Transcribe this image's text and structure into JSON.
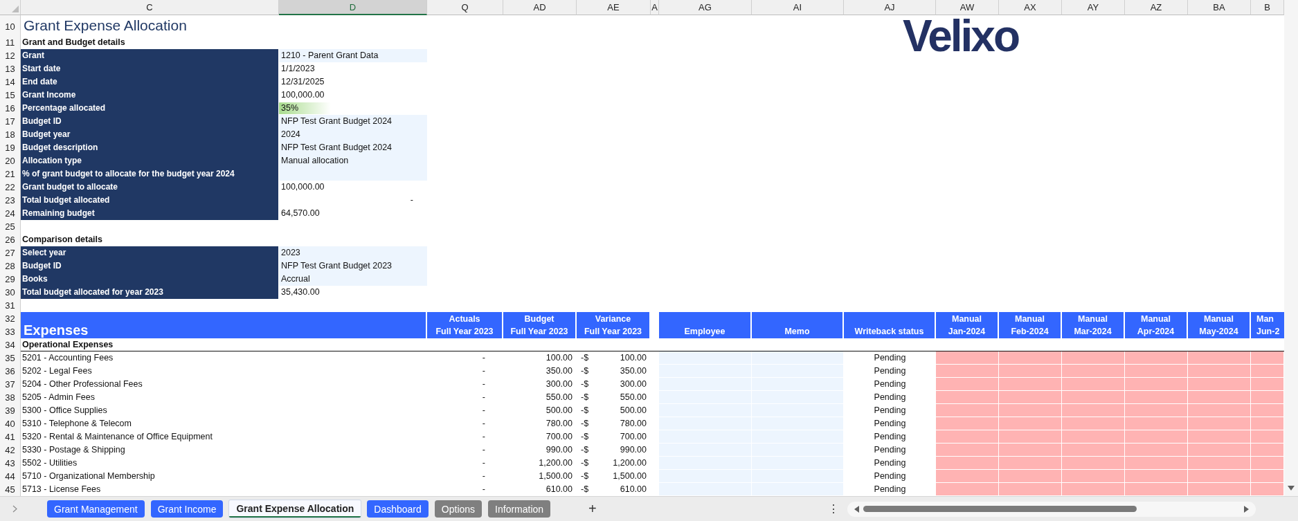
{
  "column_headers": [
    {
      "label": "C",
      "selected": false
    },
    {
      "label": "D",
      "selected": true
    },
    {
      "label": "Q",
      "selected": false
    },
    {
      "label": "AD",
      "selected": false
    },
    {
      "label": "AE",
      "selected": false
    },
    {
      "label": "A",
      "selected": false
    },
    {
      "label": "AG",
      "selected": false
    },
    {
      "label": "AI",
      "selected": false
    },
    {
      "label": "AJ",
      "selected": false
    },
    {
      "label": "AW",
      "selected": false
    },
    {
      "label": "AX",
      "selected": false
    },
    {
      "label": "AY",
      "selected": false
    },
    {
      "label": "AZ",
      "selected": false
    },
    {
      "label": "BA",
      "selected": false
    },
    {
      "label": "B",
      "selected": false
    }
  ],
  "logo": "Velixo",
  "top_rows": [
    {
      "row": "10",
      "kind": "title",
      "text": "Grant Expense Allocation"
    },
    {
      "row": "11",
      "kind": "heading",
      "text": "Grant and Budget details"
    },
    {
      "row": "12",
      "kind": "field",
      "label": "Grant",
      "value": "1210 - Parent Grant Data",
      "shaded": true
    },
    {
      "row": "13",
      "kind": "field",
      "label": "Start date",
      "value": "1/1/2023",
      "shaded": false
    },
    {
      "row": "14",
      "kind": "field",
      "label": "End date",
      "value": "12/31/2025",
      "shaded": false
    },
    {
      "row": "15",
      "kind": "field",
      "label": "Grant Income",
      "value": "100,000.00",
      "shaded": false
    },
    {
      "row": "16",
      "kind": "field",
      "label": "Percentage allocated",
      "value": "35%",
      "shaded": false,
      "level": 0.35
    },
    {
      "row": "17",
      "kind": "field",
      "label": "Budget ID",
      "value": "NFP Test Grant Budget 2024",
      "shaded": true
    },
    {
      "row": "18",
      "kind": "field",
      "label": "Budget year",
      "value": "2024",
      "shaded": true
    },
    {
      "row": "19",
      "kind": "field",
      "label": "Budget description",
      "value": "NFP Test Grant Budget 2024",
      "shaded": true
    },
    {
      "row": "20",
      "kind": "field",
      "label": "Allocation type",
      "value": "Manual allocation",
      "shaded": true
    },
    {
      "row": "21",
      "kind": "field",
      "label": "% of grant budget to allocate for the budget year 2024",
      "shaded": true
    },
    {
      "row": "22",
      "kind": "field",
      "label": "Grant budget to allocate",
      "value": "100,000.00",
      "shaded": false
    },
    {
      "row": "23",
      "kind": "field",
      "label": "Total budget allocated",
      "amount": "-",
      "shaded": false
    },
    {
      "row": "24",
      "kind": "field",
      "label": "Remaining budget",
      "value": "64,570.00",
      "shaded": false
    },
    {
      "row": "25",
      "kind": "blank"
    },
    {
      "row": "26",
      "kind": "heading",
      "text": "Comparison details"
    },
    {
      "row": "27",
      "kind": "field",
      "label": "Select year",
      "value": "2023",
      "shaded": true
    },
    {
      "row": "28",
      "kind": "field",
      "label": "Budget ID",
      "value": "NFP Test Grant Budget 2023",
      "shaded": true
    },
    {
      "row": "29",
      "kind": "field",
      "label": "Books",
      "value": "Accrual",
      "shaded": true
    },
    {
      "row": "30",
      "kind": "field",
      "label": "Total budget allocated for year 2023",
      "value": "35,430.00",
      "shaded": false
    },
    {
      "row": "31",
      "kind": "blank"
    }
  ],
  "expenses": {
    "header_rows": [
      "32",
      "33"
    ],
    "title": "Expenses",
    "comparison_columns": [
      {
        "lines": [
          "Actuals",
          "Full Year 2023"
        ]
      },
      {
        "lines": [
          "Budget",
          "Full Year 2023"
        ]
      },
      {
        "lines": [
          "Variance",
          "Full Year 2023"
        ]
      }
    ],
    "allocation_columns": [
      {
        "kind": "input",
        "lines": [
          "Employee"
        ]
      },
      {
        "kind": "input",
        "lines": [
          "Memo"
        ]
      },
      {
        "kind": "status",
        "lines": [
          "Writeback status"
        ]
      },
      {
        "kind": "month",
        "lines": [
          "Manual",
          "Jan-2024"
        ]
      },
      {
        "kind": "month",
        "lines": [
          "Manual",
          "Feb-2024"
        ]
      },
      {
        "kind": "month",
        "lines": [
          "Manual",
          "Mar-2024"
        ]
      },
      {
        "kind": "month",
        "lines": [
          "Manual",
          "Apr-2024"
        ]
      },
      {
        "kind": "month",
        "lines": [
          "Manual",
          "May-2024"
        ]
      },
      {
        "kind": "month",
        "lines": [
          "Man",
          "Jun-2"
        ]
      }
    ],
    "section": {
      "row": "34",
      "text": "Operational Expenses"
    },
    "rows": [
      {
        "row": "35",
        "account": "5201 - Accounting Fees",
        "actuals": "-",
        "budget": "100.00",
        "variance_sign": "-$",
        "variance": "100.00",
        "status": "Pending"
      },
      {
        "row": "36",
        "account": "5202 - Legal Fees",
        "actuals": "-",
        "budget": "350.00",
        "variance_sign": "-$",
        "variance": "350.00",
        "status": "Pending"
      },
      {
        "row": "37",
        "account": "5204 - Other Professional Fees",
        "actuals": "-",
        "budget": "300.00",
        "variance_sign": "-$",
        "variance": "300.00",
        "status": "Pending"
      },
      {
        "row": "38",
        "account": "5205 - Admin Fees",
        "actuals": "-",
        "budget": "550.00",
        "variance_sign": "-$",
        "variance": "550.00",
        "status": "Pending"
      },
      {
        "row": "39",
        "account": "5300 - Office Supplies",
        "actuals": "-",
        "budget": "500.00",
        "variance_sign": "-$",
        "variance": "500.00",
        "status": "Pending"
      },
      {
        "row": "40",
        "account": "5310 - Telephone & Telecom",
        "actuals": "-",
        "budget": "780.00",
        "variance_sign": "-$",
        "variance": "780.00",
        "status": "Pending"
      },
      {
        "row": "41",
        "account": "5320 - Rental & Maintenance of Office Equipment",
        "actuals": "-",
        "budget": "700.00",
        "variance_sign": "-$",
        "variance": "700.00",
        "status": "Pending"
      },
      {
        "row": "42",
        "account": "5330 - Postage & Shipping",
        "actuals": "-",
        "budget": "990.00",
        "variance_sign": "-$",
        "variance": "990.00",
        "status": "Pending"
      },
      {
        "row": "43",
        "account": "5502 - Utilities",
        "actuals": "-",
        "budget": "1,200.00",
        "variance_sign": "-$",
        "variance": "1,200.00",
        "status": "Pending"
      },
      {
        "row": "44",
        "account": "5710 - Organizational Membership",
        "actuals": "-",
        "budget": "1,500.00",
        "variance_sign": "-$",
        "variance": "1,500.00",
        "status": "Pending"
      },
      {
        "row": "45",
        "account": "5713 - License Fees",
        "actuals": "-",
        "budget": "610.00",
        "variance_sign": "-$",
        "variance": "610.00",
        "status": "Pending"
      }
    ]
  },
  "sheet_tabs": [
    {
      "label": "Grant Management",
      "selected": false,
      "color": "#3366ff"
    },
    {
      "label": "Grant Income",
      "selected": false,
      "color": "#3366ff"
    },
    {
      "label": "Grant Expense Allocation",
      "selected": true
    },
    {
      "label": "Dashboard",
      "selected": false,
      "color": "#3366ff"
    },
    {
      "label": "Options",
      "selected": false,
      "color": "#7f7f7f"
    },
    {
      "label": "Information",
      "selected": false,
      "color": "#7f7f7f"
    }
  ],
  "add_sheet": "+",
  "more_menu": "⋮"
}
